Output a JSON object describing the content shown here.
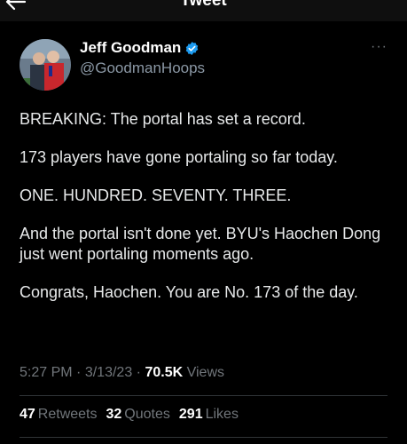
{
  "header": {
    "title": "Tweet"
  },
  "author": {
    "name": "Jeff Goodman",
    "handle": "@GoodmanHoops",
    "verified_color": "#1d9bf0"
  },
  "tweet": {
    "paragraphs": [
      "BREAKING: The portal has set a record.",
      "173 players have gone portaling so far today.",
      "ONE. HUNDRED. SEVENTY. THREE.",
      "And the portal isn't done yet. BYU's Haochen Dong just went portaling moments ago.",
      "Congrats, Haochen. You are No. 173 of the day."
    ],
    "time": "5:27 PM",
    "date": "3/13/23",
    "views_count": "70.5K",
    "views_label": "Views"
  },
  "stats": {
    "retweets_count": "47",
    "retweets_label": "Retweets",
    "quotes_count": "32",
    "quotes_label": "Quotes",
    "likes_count": "291",
    "likes_label": "Likes"
  },
  "colors": {
    "background": "#000000",
    "text": "#e7e9ea",
    "muted": "#71767b"
  }
}
